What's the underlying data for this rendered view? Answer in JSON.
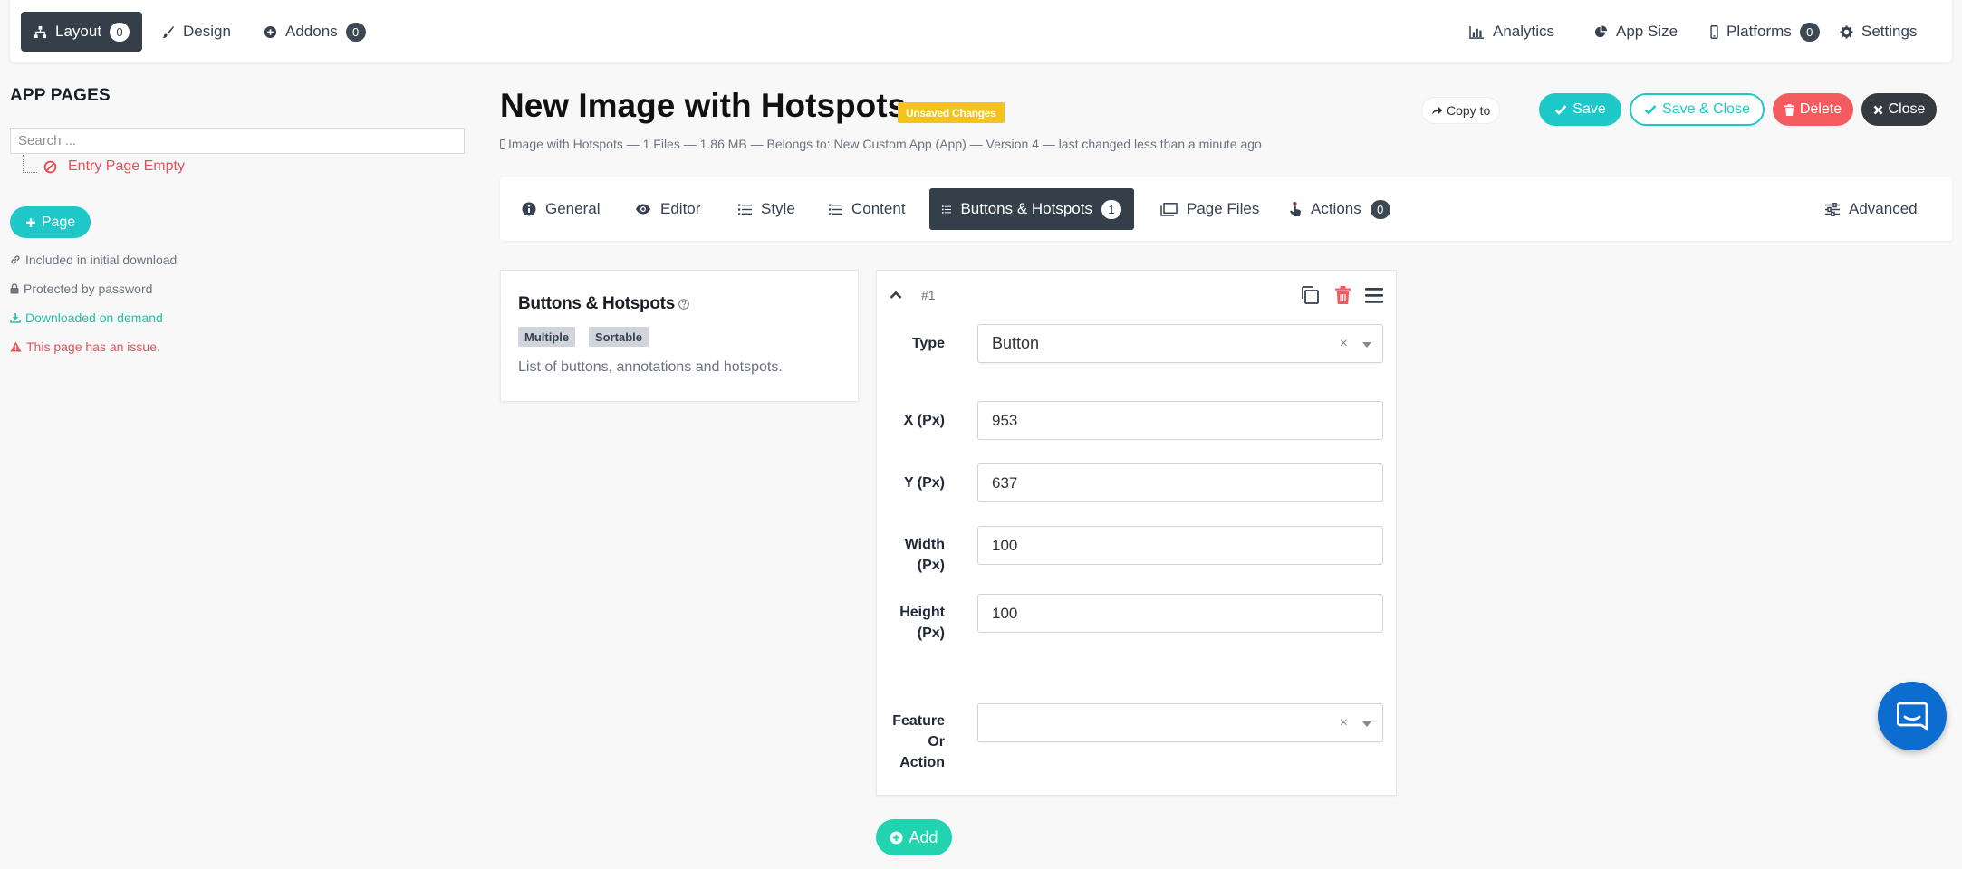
{
  "topnav": {
    "left": [
      {
        "label": "Layout",
        "badge": "0"
      },
      {
        "label": "Design"
      },
      {
        "label": "Addons",
        "badge": "0"
      }
    ],
    "right": [
      {
        "label": "Analytics"
      },
      {
        "label": "App Size"
      },
      {
        "label": "Platforms",
        "badge": "0"
      },
      {
        "label": "Settings"
      }
    ]
  },
  "sidebar": {
    "title": "APP PAGES",
    "search_placeholder": "Search ...",
    "entry_page": "Entry Page Empty",
    "add_page_label": "Page",
    "legend": [
      {
        "text": "Included in initial download",
        "color": "#6b7280"
      },
      {
        "text": "Protected by password",
        "color": "#6b7280"
      },
      {
        "text": "Downloaded on demand",
        "color": "#22c3a6"
      },
      {
        "text": "This page has an issue.",
        "color": "#e6505b"
      }
    ]
  },
  "header": {
    "title": "New Image with Hotspots",
    "unsaved_badge": "Unsaved Changes",
    "meta": "Image with Hotspots — 1 Files — 1.86 MB — Belongs to: New Custom App (App) — Version 4 — last changed less than a minute ago",
    "copy_to": "Copy to",
    "save": "Save",
    "save_close": "Save & Close",
    "delete": "Delete",
    "close": "Close"
  },
  "tabs": [
    {
      "label": "General"
    },
    {
      "label": "Editor"
    },
    {
      "label": "Style"
    },
    {
      "label": "Content"
    },
    {
      "label": "Buttons & Hotspots",
      "badge": "1",
      "active": true
    },
    {
      "label": "Page Files"
    },
    {
      "label": "Actions",
      "badge": "0"
    },
    {
      "label": "Advanced"
    }
  ],
  "info": {
    "title": "Buttons & Hotspots",
    "tags": [
      "Multiple",
      "Sortable"
    ],
    "description": "List of buttons, annotations and hotspots."
  },
  "item": {
    "number": "#1",
    "type_label": "Type",
    "type_value": "Button",
    "x_label": "X (Px)",
    "x_value": "953",
    "y_label": "Y (Px)",
    "y_value": "637",
    "width_label_1": "Width",
    "width_label_2": "(Px)",
    "width_value": "100",
    "height_label_1": "Height",
    "height_label_2": "(Px)",
    "height_value": "100",
    "feature_label_1": "Feature",
    "feature_label_2": "Or",
    "feature_label_3": "Action",
    "feature_value": "",
    "clear_glyph": "×"
  },
  "add_label": "Add",
  "colors": {
    "teal": "#1ec8c8",
    "green": "#22d3b0",
    "red": "#f45b5f",
    "dark": "#343f49",
    "yellow": "#f4c31c",
    "chat_blue": "#0c6ccf"
  }
}
